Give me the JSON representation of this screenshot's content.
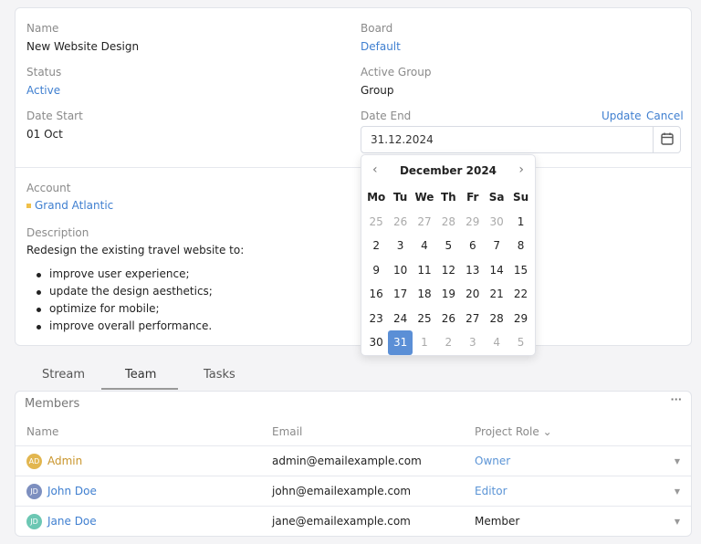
{
  "details": {
    "name_label": "Name",
    "name_value": "New Website Design",
    "board_label": "Board",
    "board_value": "Default",
    "status_label": "Status",
    "status_value": "Active",
    "active_group_label": "Active Group",
    "active_group_value": "Group",
    "date_start_label": "Date Start",
    "date_start_value": "01 Oct",
    "date_end_label": "Date End",
    "date_end_value": "31.12.2024",
    "update_label": "Update",
    "cancel_label": "Cancel",
    "account_label": "Account",
    "account_value": "Grand Atlantic",
    "description_label": "Description",
    "description_intro": "Redesign the existing travel website to:",
    "description_items": [
      "improve user experience;",
      "update the design aesthetics;",
      "optimize for mobile;",
      "improve overall performance."
    ]
  },
  "calendar": {
    "month_label": "December 2024",
    "weekdays": [
      "Mo",
      "Tu",
      "We",
      "Th",
      "Fr",
      "Sa",
      "Su"
    ],
    "days": [
      {
        "d": "25",
        "out": true
      },
      {
        "d": "26",
        "out": true
      },
      {
        "d": "27",
        "out": true
      },
      {
        "d": "28",
        "out": true
      },
      {
        "d": "29",
        "out": true
      },
      {
        "d": "30",
        "out": true
      },
      {
        "d": "1"
      },
      {
        "d": "2"
      },
      {
        "d": "3"
      },
      {
        "d": "4"
      },
      {
        "d": "5"
      },
      {
        "d": "6"
      },
      {
        "d": "7"
      },
      {
        "d": "8"
      },
      {
        "d": "9"
      },
      {
        "d": "10"
      },
      {
        "d": "11"
      },
      {
        "d": "12"
      },
      {
        "d": "13"
      },
      {
        "d": "14"
      },
      {
        "d": "15"
      },
      {
        "d": "16"
      },
      {
        "d": "17"
      },
      {
        "d": "18"
      },
      {
        "d": "19"
      },
      {
        "d": "20"
      },
      {
        "d": "21"
      },
      {
        "d": "22"
      },
      {
        "d": "23"
      },
      {
        "d": "24"
      },
      {
        "d": "25"
      },
      {
        "d": "26"
      },
      {
        "d": "27"
      },
      {
        "d": "28"
      },
      {
        "d": "29"
      },
      {
        "d": "30"
      },
      {
        "d": "31",
        "selected": true
      },
      {
        "d": "1",
        "out": true
      },
      {
        "d": "2",
        "out": true
      },
      {
        "d": "3",
        "out": true
      },
      {
        "d": "4",
        "out": true
      },
      {
        "d": "5",
        "out": true
      }
    ]
  },
  "tabs": [
    {
      "label": "Stream"
    },
    {
      "label": "Team",
      "active": true
    },
    {
      "label": "Tasks"
    }
  ],
  "members": {
    "title": "Members",
    "columns": {
      "name": "Name",
      "email": "Email",
      "role": "Project Role"
    },
    "rows": [
      {
        "initials": "AD",
        "name": "Admin",
        "email": "admin@emailexample.com",
        "role": "Owner",
        "avatar_color": "#e2b64f",
        "name_color": "#c9952c",
        "role_color": "#5b94d6"
      },
      {
        "initials": "JD",
        "name": "John Doe",
        "email": "john@emailexample.com",
        "role": "Editor",
        "avatar_color": "#7d8fbf",
        "name_color": "#3f7fd0",
        "role_color": "#5b94d6"
      },
      {
        "initials": "JD",
        "name": "Jane Doe",
        "email": "jane@emailexample.com",
        "role": "Member",
        "avatar_color": "#6cc7b3",
        "name_color": "#3f7fd0",
        "role_color": "#222222"
      }
    ]
  }
}
